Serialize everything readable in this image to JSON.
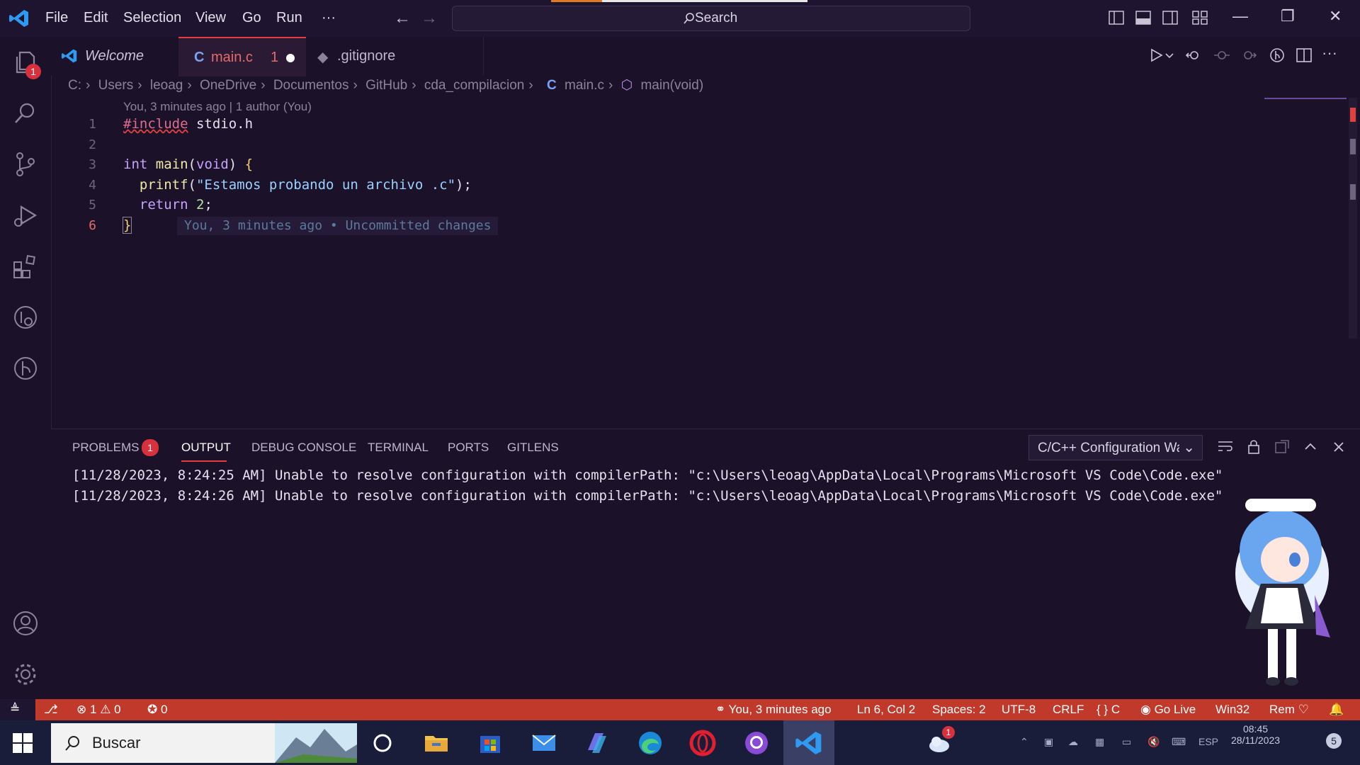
{
  "menu": {
    "items": [
      "File",
      "Edit",
      "Selection",
      "View",
      "Go",
      "Run",
      "···"
    ]
  },
  "search": {
    "label": "Search"
  },
  "tabs": [
    {
      "label": "Welcome"
    },
    {
      "label": "main.c",
      "problems": "1"
    },
    {
      "label": ".gitignore"
    }
  ],
  "activity": {
    "explorer_badge": "1"
  },
  "breadcrumb": {
    "items": [
      "C:",
      "Users",
      "leoag",
      "OneDrive",
      "Documentos",
      "GitHub",
      "cda_compilacion"
    ],
    "file": "main.c",
    "symbol": "main(void)"
  },
  "editor": {
    "blame_header": "You, 3 minutes ago | 1 author (You)",
    "line_numbers": [
      "1",
      "2",
      "3",
      "4",
      "5",
      "6"
    ],
    "inline_blame": "You, 3 minutes ago • Uncommitted changes"
  },
  "panel": {
    "tabs": [
      "PROBLEMS",
      "OUTPUT",
      "DEBUG CONSOLE",
      "TERMINAL",
      "PORTS",
      "GITLENS"
    ],
    "problems_count": "1",
    "output_channel": "C/C++ Configuration Warnings",
    "output_lines": [
      "[11/28/2023, 8:24:25 AM] Unable to resolve configuration with compilerPath: \"c:\\Users\\leoag\\AppData\\Local\\Programs\\Microsoft VS Code\\Code.exe\"",
      "[11/28/2023, 8:24:26 AM] Unable to resolve configuration with compilerPath: \"c:\\Users\\leoag\\AppData\\Local\\Programs\\Microsoft VS Code\\Code.exe\""
    ]
  },
  "status": {
    "errors": "1",
    "warnings": "0",
    "ports": "0",
    "blame": "You, 3 minutes ago",
    "position": "Ln 6, Col 2",
    "spaces": "Spaces: 2",
    "encoding": "UTF-8",
    "eol": "CRLF",
    "language": "C",
    "golive": "Go Live",
    "platform": "Win32",
    "rem": "Rem",
    "color": "#c0392b"
  },
  "taskbar": {
    "search_placeholder": "Buscar",
    "clock_time": "08:45",
    "clock_date": "28/11/2023",
    "notif_count": "5",
    "language": "ESP",
    "weather_badge": "1"
  },
  "colors": {
    "accent": "#e04040",
    "background": "#1b1229"
  }
}
